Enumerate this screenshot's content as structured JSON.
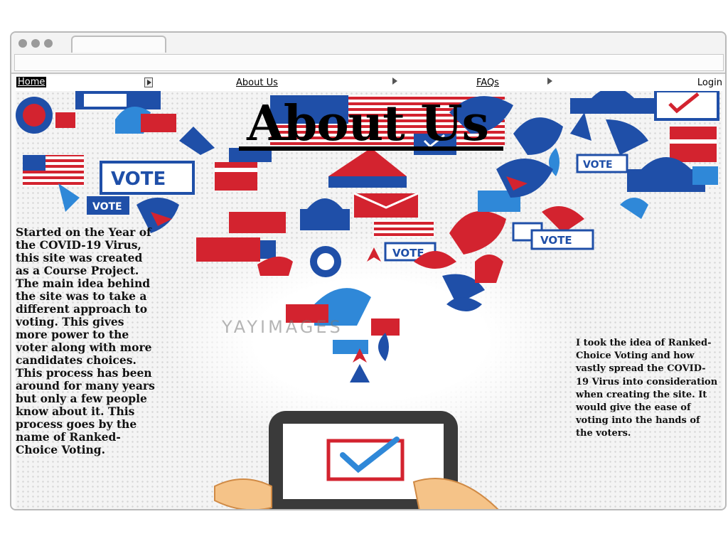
{
  "nav": {
    "home": "Home",
    "about": "About Us",
    "faqs": "FAQs",
    "login": "Login"
  },
  "page": {
    "title": "About Us",
    "watermark": "YAYIMAGES",
    "left_paragraph": "Started on the Year of the COVID-19 Virus, this site was created as a Course Project. The main idea behind the site was to take a different approach to voting. This gives more power to the voter along with more candidates choices. This process has been around for many years but only a few people know about it. This process goes by the name of Ranked-Choice Voting.",
    "right_paragraph": "I took the idea of Ranked-Choice Voting and how vastly spread the COVID-19 Virus into consideration when creating the site. It would give the ease of voting into the hands of the voters."
  },
  "illustration": {
    "vote_labels": [
      "VOTE",
      "VOTE",
      "VOTE",
      "VOTE",
      "VOTE"
    ],
    "colors": {
      "red": "#d3232f",
      "blue": "#1f4fa8",
      "light_blue": "#2f88d8",
      "white": "#ffffff",
      "phone": "#3a3a3a",
      "hand": "#f5c388"
    }
  }
}
